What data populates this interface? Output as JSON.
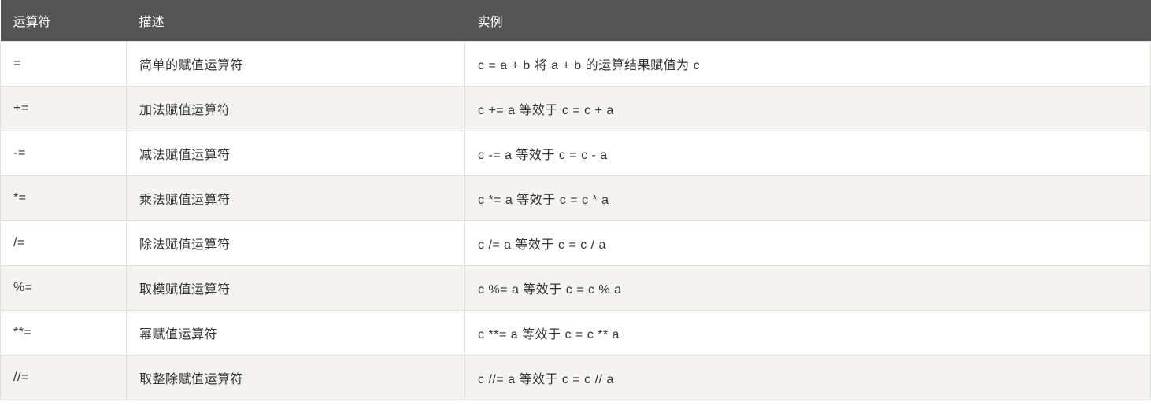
{
  "table": {
    "headers": {
      "operator": "运算符",
      "description": "描述",
      "example": "实例"
    },
    "rows": [
      {
        "operator": "=",
        "description": "简单的赋值运算符",
        "example": "c = a + b 将 a + b 的运算结果赋值为 c"
      },
      {
        "operator": "+=",
        "description": "加法赋值运算符",
        "example": "c += a 等效于 c = c + a"
      },
      {
        "operator": "-=",
        "description": "减法赋值运算符",
        "example": "c -= a 等效于 c = c - a"
      },
      {
        "operator": "*=",
        "description": "乘法赋值运算符",
        "example": "c *= a 等效于 c = c * a"
      },
      {
        "operator": "/=",
        "description": "除法赋值运算符",
        "example": "c /= a 等效于 c = c / a"
      },
      {
        "operator": "%=",
        "description": "取模赋值运算符",
        "example": "c %= a 等效于 c = c % a"
      },
      {
        "operator": "**=",
        "description": "幂赋值运算符",
        "example": "c **= a 等效于 c = c ** a"
      },
      {
        "operator": "//=",
        "description": "取整除赋值运算符",
        "example": "c //= a 等效于 c = c // a"
      }
    ]
  }
}
